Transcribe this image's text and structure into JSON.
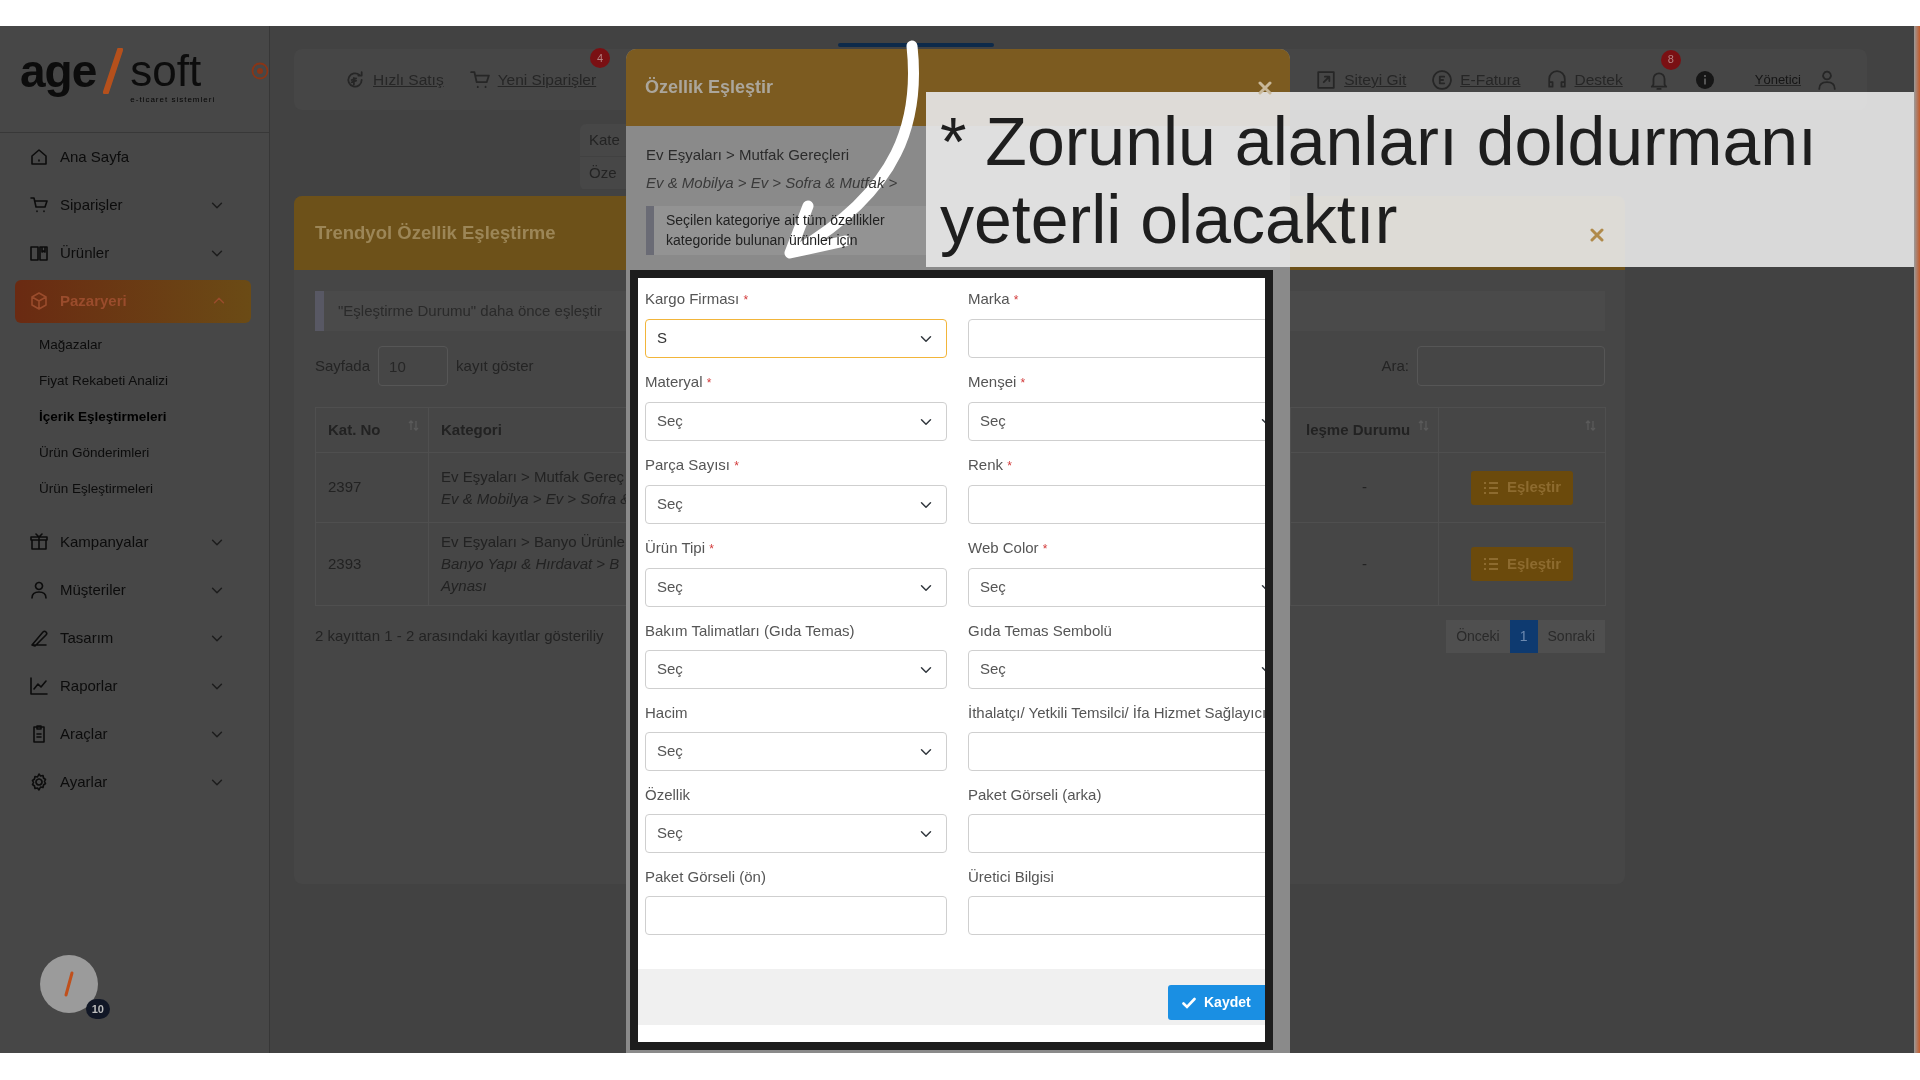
{
  "logo": {
    "name_left": "age",
    "name_right": "soft",
    "tagline": "e-ticaret sistemleri"
  },
  "sidebar": {
    "items": [
      {
        "label": "Ana Sayfa",
        "kind": "link",
        "selected": false
      },
      {
        "label": "Siparişler",
        "kind": "group",
        "selected": false,
        "expanded": false
      },
      {
        "label": "Ürünler",
        "kind": "group",
        "selected": false,
        "expanded": false
      },
      {
        "label": "Pazaryeri",
        "kind": "group",
        "selected": true,
        "expanded": true,
        "children": [
          {
            "label": "Mağazalar",
            "selected": false
          },
          {
            "label": "Fiyat Rekabeti Analizi",
            "selected": false
          },
          {
            "label": "İçerik Eşleştirmeleri",
            "selected": true
          },
          {
            "label": "Ürün Gönderimleri",
            "selected": false
          },
          {
            "label": "Ürün Eşleştirmeleri",
            "selected": false
          }
        ]
      },
      {
        "label": "Kampanyalar",
        "kind": "group",
        "selected": false,
        "expanded": false
      },
      {
        "label": "Müşteriler",
        "kind": "group",
        "selected": false,
        "expanded": false
      },
      {
        "label": "Tasarım",
        "kind": "group",
        "selected": false,
        "expanded": false
      },
      {
        "label": "Raporlar",
        "kind": "group",
        "selected": false,
        "expanded": false
      },
      {
        "label": "Araçlar",
        "kind": "group",
        "selected": false,
        "expanded": false
      },
      {
        "label": "Ayarlar",
        "kind": "group",
        "selected": false,
        "expanded": false
      }
    ]
  },
  "user_avatar": {
    "badge": "10"
  },
  "topbar": {
    "left_items": [
      {
        "label": "Hızlı Satış"
      },
      {
        "label": "Yeni Siparişler",
        "badge": "4"
      }
    ],
    "right_items": [
      {
        "label": "Siteyi Git"
      },
      {
        "label": "E-Fatura"
      },
      {
        "label": "Destek"
      }
    ],
    "notifications_badge": "8",
    "user": "Yönetici"
  },
  "side_tabs": [
    "Kate",
    "Öze"
  ],
  "panel": {
    "title": "Trendyol Özellik Eşleştirme",
    "notice": "\"Eşleştirme Durumu\" daha önce eşleştir",
    "page_size_label": "Sayfada",
    "page_size": "10",
    "page_size_suffix": "kayıt göster",
    "search_label": "Ara:",
    "table": {
      "columns": [
        "Kat. No",
        "Kategori",
        "leşme Durumu"
      ],
      "rows": [
        {
          "kat_no": "2397",
          "category": "Ev Eşyaları > Mutfak Gereç",
          "category_path": [
            "Ev & Mobilya > Ev > Sofra &"
          ],
          "status": "-",
          "action": "Eşleştir"
        },
        {
          "kat_no": "2393",
          "category": "Ev Eşyaları > Banyo Ürünle",
          "category_path": [
            "Banyo Yapı & Hırdavat > B",
            "Aynası"
          ],
          "status": "-",
          "action": "Eşleştir"
        }
      ]
    },
    "summary": "2 kayıttan 1 - 2 arasındaki kayıtlar gösteriliy",
    "pagination": [
      {
        "label": "Önceki",
        "selected": false,
        "disabled": true
      },
      {
        "label": "1",
        "selected": true,
        "disabled": false
      },
      {
        "label": "Sonraki",
        "selected": false,
        "disabled": true
      }
    ]
  },
  "modal": {
    "title": "Özellik Eşleştir",
    "category": "Ev Eşyaları > Mutfak Gereçleri",
    "category_path": "Ev & Mobilya > Ev > Sofra & Mutfak >",
    "info_lines": [
      "Seçilen kategoriye ait tüm özellikler",
      "kategoride bulunan ürünler için"
    ],
    "fields": [
      {
        "label": "Kargo Firması",
        "required_mark": "*",
        "kind": "select",
        "value": "S",
        "focused": true
      },
      {
        "label": "Marka",
        "required_mark": "*",
        "kind": "text",
        "focused": false
      },
      {
        "label": "Materyal",
        "required_mark": "*",
        "kind": "select",
        "value": "Seç",
        "focused": false
      },
      {
        "label": "Menşei",
        "required_mark": "*",
        "kind": "select",
        "value": "Seç",
        "focused": false
      },
      {
        "label": "Parça Sayısı",
        "required_mark": "*",
        "kind": "select",
        "value": "Seç",
        "focused": false
      },
      {
        "label": "Renk",
        "required_mark": "*",
        "kind": "text",
        "focused": false
      },
      {
        "label": "Ürün Tipi",
        "required_mark": "*",
        "kind": "select",
        "value": "Seç",
        "focused": false
      },
      {
        "label": "Web Color",
        "required_mark": "*",
        "kind": "select",
        "value": "Seç",
        "focused": false
      },
      {
        "label": "Bakım Talimatları (Gıda Temas)",
        "kind": "select",
        "value": "Seç",
        "focused": false
      },
      {
        "label": "Gıda Temas Sembolü",
        "kind": "select",
        "value": "Seç",
        "focused": false
      },
      {
        "label": "Hacim",
        "kind": "select",
        "value": "Seç",
        "focused": false
      },
      {
        "label": "İthalatçı/ Yetkili Temsilci/ İfa Hizmet Sağlayıcı",
        "kind": "text",
        "focused": false
      },
      {
        "label": "Özellik",
        "kind": "select",
        "value": "Seç",
        "focused": false
      },
      {
        "label": "Paket Görseli (arka)",
        "kind": "text",
        "focused": false
      },
      {
        "label": "Paket Görseli (ön)",
        "kind": "text",
        "focused": false
      },
      {
        "label": "Üretici Bilgisi",
        "kind": "text",
        "focused": false
      }
    ],
    "save_button": "Kaydet"
  },
  "annotation": {
    "lines": [
      "* Zorunlu alanları doldurmanı",
      "yeterli olacaktır"
    ]
  }
}
